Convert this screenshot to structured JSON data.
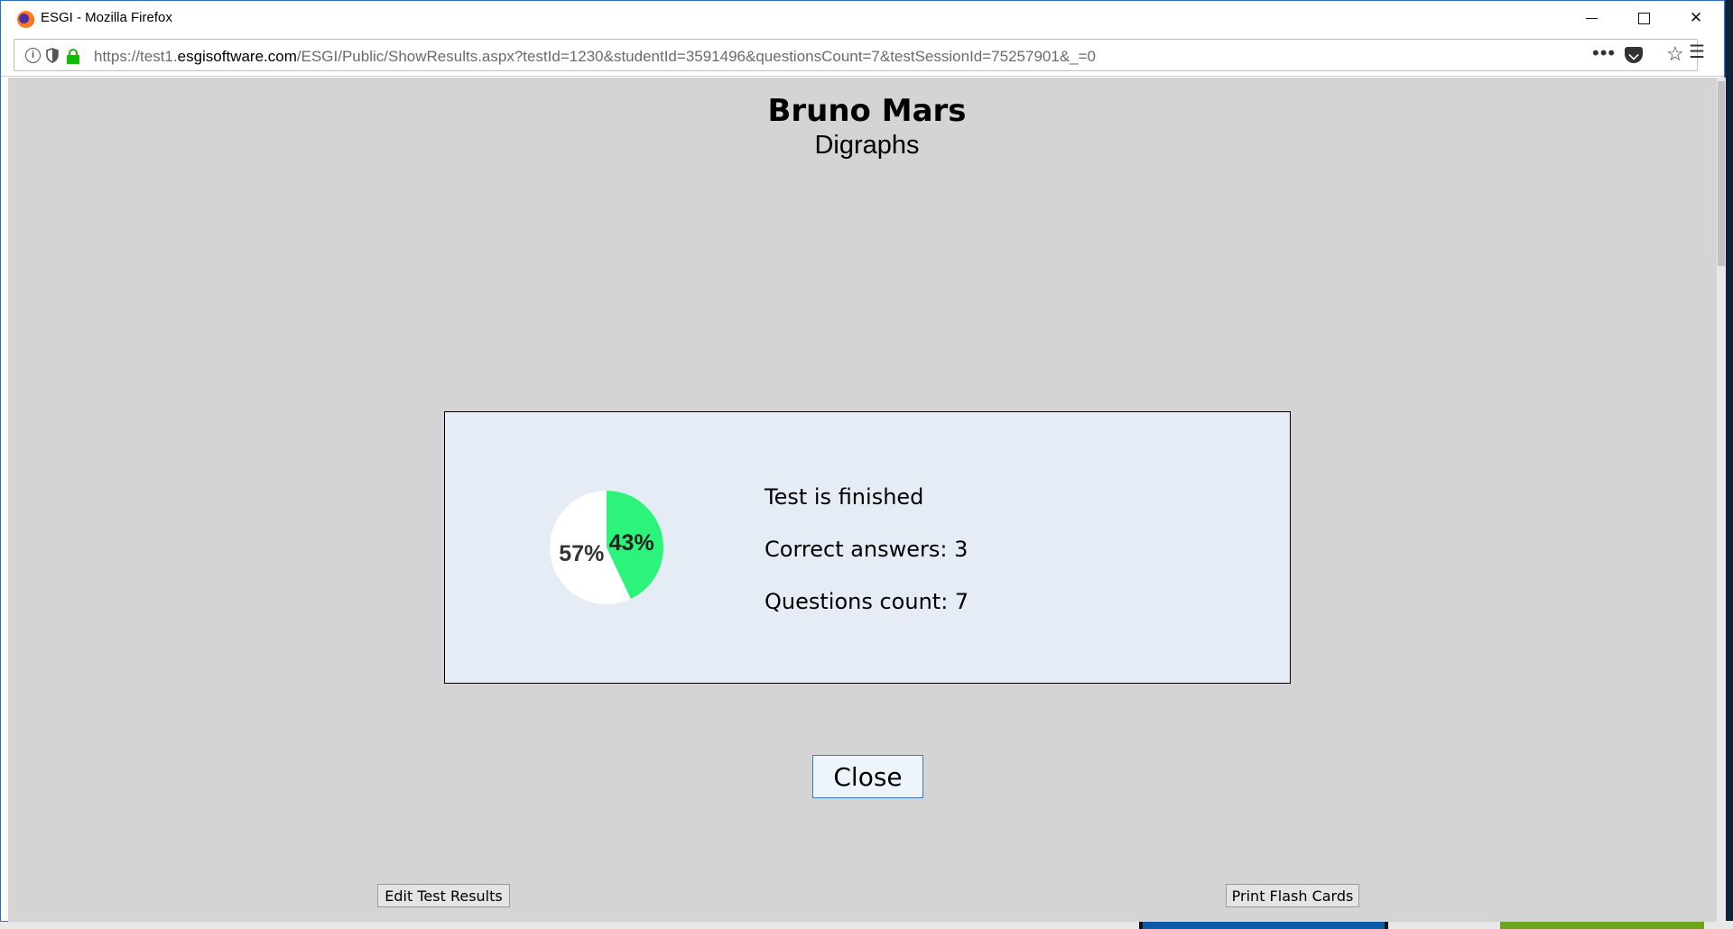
{
  "window": {
    "title": "ESGI - Mozilla Firefox"
  },
  "urlbar": {
    "url_prefix": "https://test1.",
    "url_host": "esgisoftware.com",
    "url_path": "/ESGI/Public/ShowResults.aspx?testId=1230&studentId=3591496&questionsCount=7&testSessionId=75257901&_=0"
  },
  "header": {
    "student_name": "Bruno Mars",
    "test_name": "Digraphs"
  },
  "results": {
    "status_text": "Test is finished",
    "correct_answers_text": "Correct answers: 3",
    "questions_count_text": "Questions count: 7",
    "correct_answers": 3,
    "questions_count": 7
  },
  "chart_data": {
    "type": "pie",
    "slices": [
      {
        "label": "43%",
        "value": 43,
        "color": "#2cf37a"
      },
      {
        "label": "57%",
        "value": 57,
        "color": "#ffffff"
      }
    ]
  },
  "buttons": {
    "close": "Close",
    "edit_test_results": "Edit Test Results",
    "print_flash_cards": "Print Flash Cards"
  },
  "icons": {
    "browser": "firefox-logo-icon",
    "info": "info-icon",
    "tracking": "shield-icon",
    "secure": "lock-icon",
    "page_actions": "more-icon",
    "pocket": "pocket-icon",
    "bookmark": "star-icon",
    "menu": "hamburger-menu-icon"
  }
}
